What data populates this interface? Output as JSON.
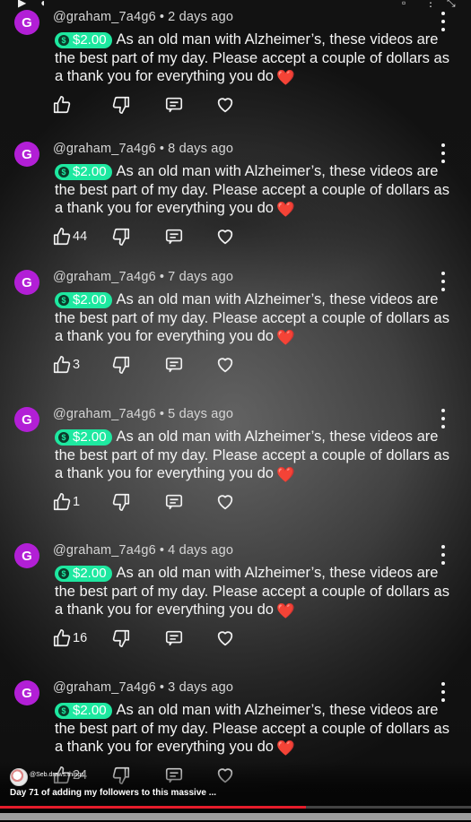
{
  "comments": [
    {
      "avatar": "G",
      "author": "@graham_7a4g6",
      "time": "2 days ago",
      "amount": "$2.00",
      "text": "As an old man with Alzheimer’s, these videos are the best part of my day.  Please accept a couple of dollars as a thank you for everything you do",
      "likes": ""
    },
    {
      "avatar": "G",
      "author": "@graham_7a4g6",
      "time": "8 days ago",
      "amount": "$2.00",
      "text": "As an old man with Alzheimer’s, these videos are the best part of my day.  Please accept a couple of dollars as a thank you for everything you do",
      "likes": "44"
    },
    {
      "avatar": "G",
      "author": "@graham_7a4g6",
      "time": "7 days ago",
      "amount": "$2.00",
      "text": "As an old man with Alzheimer’s, these videos are the best part of my day.  Please accept a couple of dollars as a thank you for everything you do",
      "likes": "3"
    },
    {
      "avatar": "G",
      "author": "@graham_7a4g6",
      "time": "5 days ago",
      "amount": "$2.00",
      "text": "As an old man with Alzheimer’s, these videos are the best part of my day.  Please accept a couple of dollars as a thank you for everything you do",
      "likes": "1"
    },
    {
      "avatar": "G",
      "author": "@graham_7a4g6",
      "time": "4 days ago",
      "amount": "$2.00",
      "text": "As an old man with Alzheimer’s, these videos are the best part of my day.  Please accept a couple of dollars as a thank you for everything you do",
      "likes": "16"
    },
    {
      "avatar": "G",
      "author": "@graham_7a4g6",
      "time": "3 days ago",
      "amount": "$2.00",
      "text": "As an old man with Alzheimer’s, these videos are the best part of my day.  Please accept a couple of dollars as a thank you for everything you do",
      "likes": "24"
    }
  ],
  "separator": "•",
  "heart_emoji": "❤️",
  "video": {
    "channel": "@Seb.draws.things",
    "title": "Day 71 of adding my followers to this massive ...",
    "progress": 0.65
  },
  "colors": {
    "avatar": "#b21fd6",
    "super_thanks_chip": "#1ee8a0",
    "progress": "#e51c2b"
  },
  "icons": [
    "play-icon",
    "volume-icon",
    "kebab-menu-icon",
    "thumbs-up-icon",
    "thumbs-down-icon",
    "reply-icon",
    "heart-icon"
  ]
}
